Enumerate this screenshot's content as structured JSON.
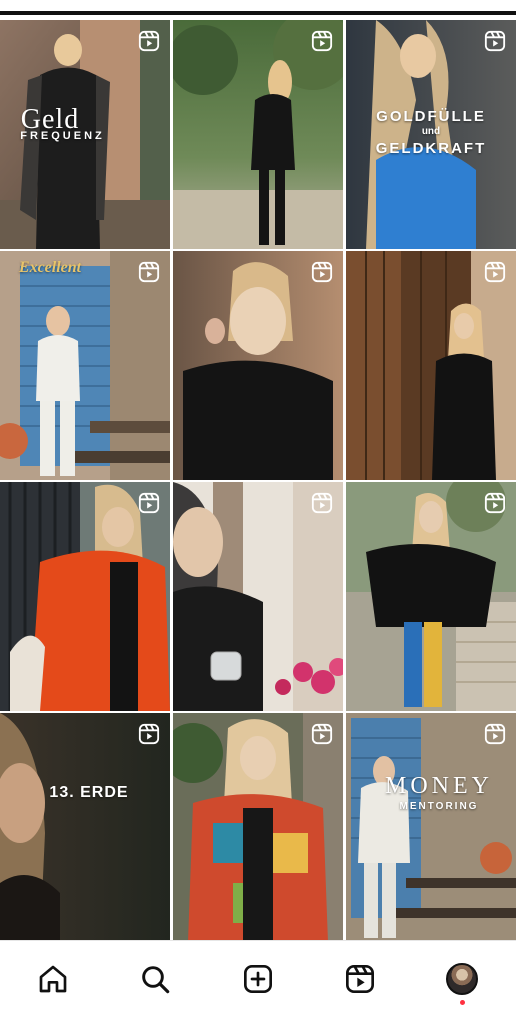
{
  "colors": {
    "background": "#ffffff",
    "icon": "#111111",
    "notification_dot": "#ff3040",
    "gold_text": "#e7c46a"
  },
  "grid": {
    "posts": [
      {
        "id": "post-1",
        "type": "reel",
        "icon": "reels-icon",
        "overlay": [
          "Geld",
          "FREQUENZ"
        ]
      },
      {
        "id": "post-2",
        "type": "reel",
        "icon": "reels-icon",
        "overlay": []
      },
      {
        "id": "post-3",
        "type": "reel",
        "icon": "reels-icon",
        "overlay": [
          "GOLDFÜLLE",
          "und",
          "GELDKRAFT"
        ]
      },
      {
        "id": "post-4",
        "type": "reel",
        "icon": "reels-icon",
        "overlay": [
          "Excellent"
        ]
      },
      {
        "id": "post-5",
        "type": "reel",
        "icon": "reels-icon",
        "overlay": []
      },
      {
        "id": "post-6",
        "type": "reel",
        "icon": "reels-icon",
        "overlay": []
      },
      {
        "id": "post-7",
        "type": "reel",
        "icon": "reels-icon",
        "overlay": []
      },
      {
        "id": "post-8",
        "type": "reel",
        "icon": "reels-icon",
        "overlay": []
      },
      {
        "id": "post-9",
        "type": "reel",
        "icon": "reels-icon",
        "overlay": []
      },
      {
        "id": "post-10",
        "type": "reel",
        "icon": "reels-icon",
        "overlay": [
          "13. ERDE"
        ]
      },
      {
        "id": "post-11",
        "type": "reel",
        "icon": "reels-icon",
        "overlay": []
      },
      {
        "id": "post-12",
        "type": "reel",
        "icon": "reels-icon",
        "overlay": [
          "MONEY",
          "MENTORING"
        ]
      }
    ]
  },
  "bottom_nav": {
    "items": [
      {
        "name": "home",
        "icon": "home-icon"
      },
      {
        "name": "search",
        "icon": "search-icon"
      },
      {
        "name": "create",
        "icon": "plus-square-icon"
      },
      {
        "name": "reels",
        "icon": "reels-icon"
      },
      {
        "name": "profile",
        "icon": "avatar"
      }
    ],
    "profile_has_notification": true
  }
}
